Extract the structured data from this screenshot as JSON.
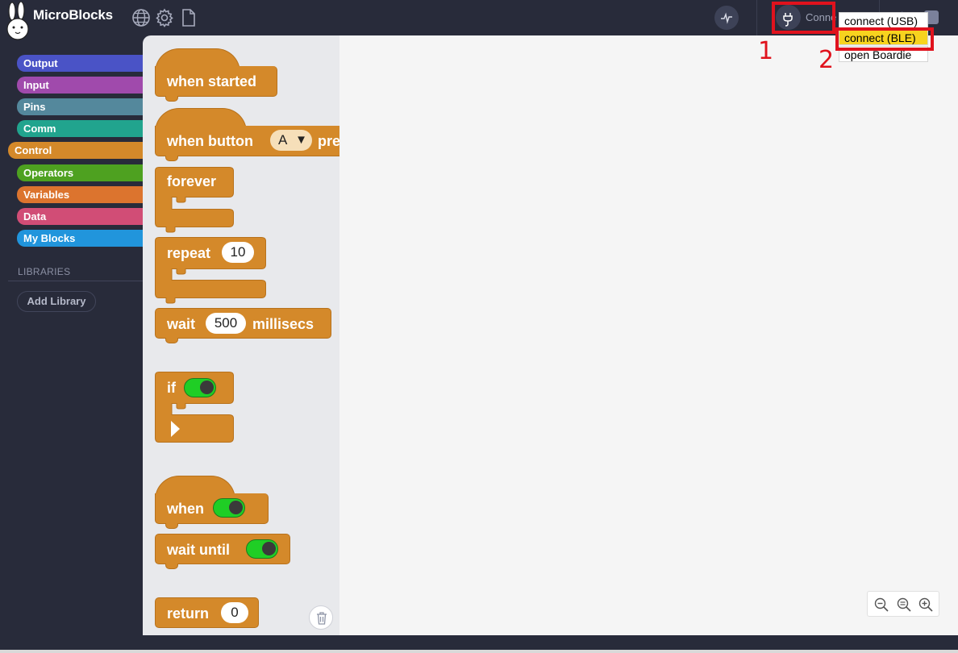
{
  "app": {
    "title": "MicroBlocks"
  },
  "toolbar": {
    "connect_label": "Conne"
  },
  "categories": [
    {
      "label": "Output",
      "color": "#4a53c6"
    },
    {
      "label": "Input",
      "color": "#a04aac"
    },
    {
      "label": "Pins",
      "color": "#54889c"
    },
    {
      "label": "Comm",
      "color": "#21a48e"
    },
    {
      "label": "Control",
      "color": "#d4892a"
    },
    {
      "label": "Operators",
      "color": "#4ea120"
    },
    {
      "label": "Variables",
      "color": "#dc742e"
    },
    {
      "label": "Data",
      "color": "#d14d76"
    },
    {
      "label": "My Blocks",
      "color": "#2195dc"
    }
  ],
  "libraries": {
    "title": "LIBRARIES",
    "add_label": "Add Library"
  },
  "palette": {
    "when_started": "when started",
    "when_button_prefix": "when button",
    "when_button_option": "A",
    "when_button_suffix": "pre",
    "forever": "forever",
    "repeat": "repeat",
    "repeat_count": "10",
    "wait": "wait",
    "wait_value": "500",
    "wait_unit": "millisecs",
    "if": "if",
    "when": "when",
    "wait_until": "wait until",
    "return": "return",
    "return_value": "0"
  },
  "connect_menu": {
    "items": [
      "connect (USB)",
      "connect (BLE)",
      "open Boardie"
    ],
    "highlighted_index": 1
  },
  "annotations": {
    "labels": [
      "1",
      "2"
    ],
    "color": "#e0121d"
  }
}
